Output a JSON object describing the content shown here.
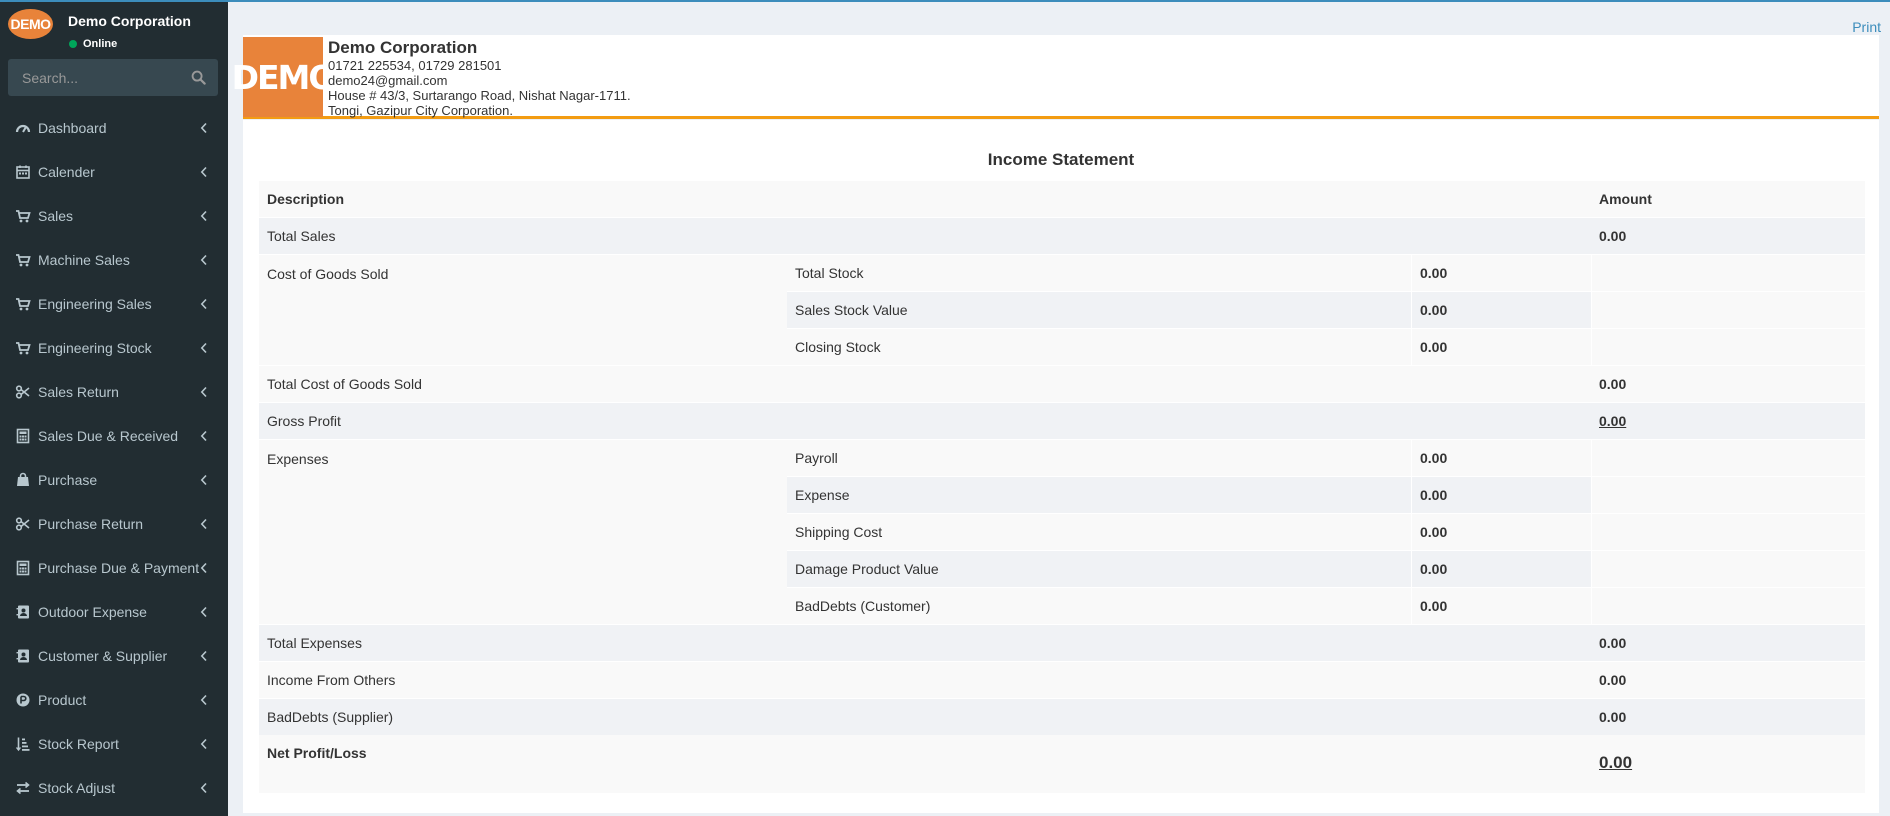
{
  "sidebar": {
    "logo_text": "DEMO",
    "user_name": "Demo Corporation",
    "status": "Online",
    "search_placeholder": "Search...",
    "items": [
      {
        "label": "Dashboard",
        "icon": "dashboard-icon"
      },
      {
        "label": "Calender",
        "icon": "calendar-icon"
      },
      {
        "label": "Sales",
        "icon": "cart-icon"
      },
      {
        "label": "Machine Sales",
        "icon": "cart-icon"
      },
      {
        "label": "Engineering Sales",
        "icon": "cart-icon"
      },
      {
        "label": "Engineering Stock",
        "icon": "cart-icon"
      },
      {
        "label": "Sales Return",
        "icon": "scissors-icon"
      },
      {
        "label": "Sales Due & Received",
        "icon": "calculator-icon"
      },
      {
        "label": "Purchase",
        "icon": "shopping-bag-icon"
      },
      {
        "label": "Purchase Return",
        "icon": "scissors-icon"
      },
      {
        "label": "Purchase Due & Payment",
        "icon": "calculator-icon"
      },
      {
        "label": "Outdoor Expense",
        "icon": "address-book-icon"
      },
      {
        "label": "Customer & Supplier",
        "icon": "address-book-icon"
      },
      {
        "label": "Product",
        "icon": "product-hunt-icon"
      },
      {
        "label": "Stock Report",
        "icon": "sort-amount-icon"
      },
      {
        "label": "Stock Adjust",
        "icon": "exchange-icon"
      }
    ]
  },
  "header": {
    "print_label": "Print"
  },
  "company": {
    "logo_text": "DEMO",
    "name": "Demo Corporation",
    "phone": "01721 225534, 01729 281501",
    "email": "demo24@gmail.com",
    "address_line1": "House # 43/3, Surtarango Road, Nishat Nagar-1711.",
    "address_line2": "Tongi, Gazipur City Corporation."
  },
  "report": {
    "title": "Income Statement",
    "col_description": "Description",
    "col_amount": "Amount",
    "total_sales_label": "Total Sales",
    "total_sales": "0.00",
    "cogs_label": "Cost of Goods Sold",
    "cogs_items": [
      {
        "label": "Total Stock",
        "value": "0.00"
      },
      {
        "label": "Sales Stock Value",
        "value": "0.00"
      },
      {
        "label": "Closing Stock",
        "value": "0.00"
      }
    ],
    "total_cogs_label": "Total Cost of Goods Sold",
    "total_cogs": "0.00",
    "gross_profit_label": "Gross Profit",
    "gross_profit": "0.00",
    "expenses_label": "Expenses",
    "expense_items": [
      {
        "label": "Payroll",
        "value": "0.00"
      },
      {
        "label": "Expense",
        "value": "0.00"
      },
      {
        "label": "Shipping Cost",
        "value": "0.00"
      },
      {
        "label": "Damage Product Value",
        "value": "0.00"
      },
      {
        "label": "BadDebts (Customer)",
        "value": "0.00"
      }
    ],
    "total_expenses_label": "Total Expenses",
    "total_expenses": "0.00",
    "income_others_label": "Income From Others",
    "income_others": "0.00",
    "baddebts_supplier_label": "BadDebts (Supplier)",
    "baddebts_supplier": "0.00",
    "net_profit_label": "Net Profit/Loss",
    "net_profit": "0.00"
  }
}
